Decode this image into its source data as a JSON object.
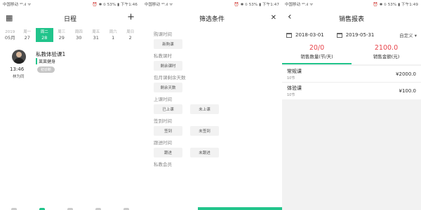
{
  "panel1": {
    "status": {
      "carrier": "中国移动 ⁴ᴳ.ıl ᯤ",
      "right": "⏰ ✱ ⦸ 53% ▮ 下午1:46"
    },
    "header": {
      "title": "日程",
      "left_icon": "calendar-icon",
      "right_icon": "plus-icon",
      "right_glyph": "+",
      "left_glyph": "▦"
    },
    "week": [
      {
        "label": "2019",
        "num": "05月",
        "today": false
      },
      {
        "label": "周一",
        "num": "27",
        "today": false
      },
      {
        "label": "周二",
        "num": "28",
        "today": true
      },
      {
        "label": "周三",
        "num": "29",
        "today": false
      },
      {
        "label": "周四",
        "num": "30",
        "today": false
      },
      {
        "label": "周五",
        "num": "31",
        "today": false
      },
      {
        "label": "周六",
        "num": "1",
        "today": false
      },
      {
        "label": "周日",
        "num": "2",
        "today": false
      }
    ],
    "event": {
      "name": "私教体验课1",
      "gym": "莱莱健身",
      "tag": "初诊断",
      "time": "13:46",
      "coach": "林为同"
    }
  },
  "panel2": {
    "status": {
      "carrier": "中国移动 ⁴ᴳ.ıl ᯤ",
      "right": "⏰ ✱ ⦸ 53% ▮ 下午1:47"
    },
    "header": {
      "title": "筛选条件",
      "close_glyph": "✕"
    },
    "sections": [
      {
        "label": "购课时间",
        "options": [
          "新购课"
        ]
      },
      {
        "label": "私教课时",
        "options": [
          "剩余课时"
        ]
      },
      {
        "label": "包月课剩余天数",
        "options": [
          "剩余天数"
        ]
      },
      {
        "label": "上课时间",
        "options": [
          "已上课",
          "未上课"
        ]
      },
      {
        "label": "签到时间",
        "options": [
          "签到",
          "未签到"
        ]
      },
      {
        "label": "跟进时间",
        "options": [
          "跟进",
          "未跟进"
        ]
      },
      {
        "label": "私教会员",
        "options": []
      }
    ]
  },
  "panel3": {
    "status": {
      "carrier": "中国移动 ⁴ᴳ.ıl ᯤ",
      "right": "⏰ ✱ ⦸ 53% ▮ 下午1:49"
    },
    "header": {
      "title": "销售报表",
      "back_glyph": "‹"
    },
    "date_start": "2018-03-01",
    "date_end": "2019-05-31",
    "custom_label": "自定义 ▾",
    "stats": [
      {
        "value": "20/0",
        "label": "销售数量(节/天)",
        "selected": true
      },
      {
        "value": "2100.0",
        "label": "销售金额(元)",
        "selected": false
      }
    ],
    "rows": [
      {
        "name": "常规课",
        "count": "10节",
        "amount": "¥2000.0"
      },
      {
        "name": "体验课",
        "count": "10节",
        "amount": "¥100.0"
      }
    ]
  },
  "colors": {
    "accent": "#21c48b",
    "value_red": "#e8434a"
  }
}
